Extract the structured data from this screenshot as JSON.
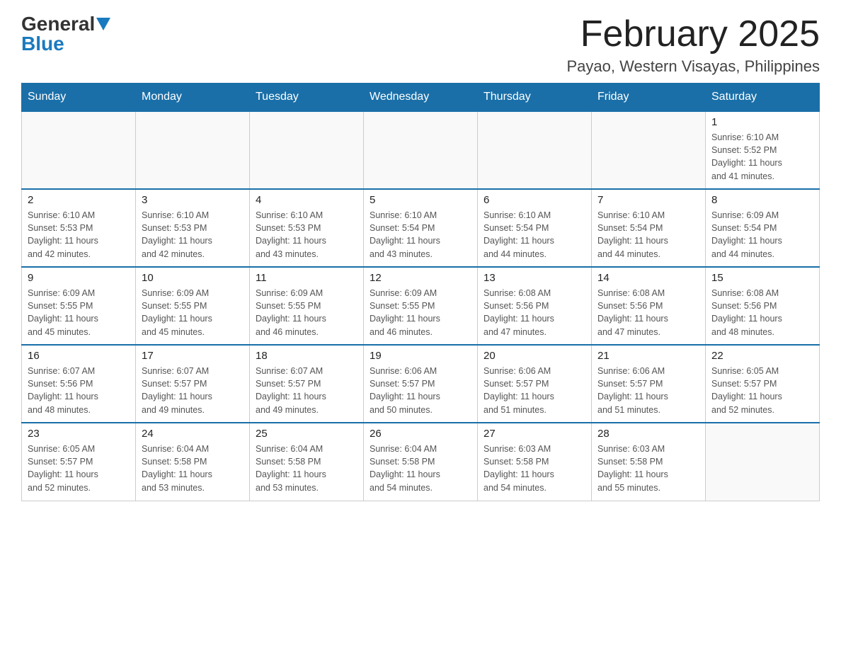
{
  "logo": {
    "general": "General",
    "blue": "Blue"
  },
  "title": {
    "month": "February 2025",
    "location": "Payao, Western Visayas, Philippines"
  },
  "weekdays": [
    "Sunday",
    "Monday",
    "Tuesday",
    "Wednesday",
    "Thursday",
    "Friday",
    "Saturday"
  ],
  "weeks": [
    [
      {
        "day": "",
        "info": ""
      },
      {
        "day": "",
        "info": ""
      },
      {
        "day": "",
        "info": ""
      },
      {
        "day": "",
        "info": ""
      },
      {
        "day": "",
        "info": ""
      },
      {
        "day": "",
        "info": ""
      },
      {
        "day": "1",
        "info": "Sunrise: 6:10 AM\nSunset: 5:52 PM\nDaylight: 11 hours\nand 41 minutes."
      }
    ],
    [
      {
        "day": "2",
        "info": "Sunrise: 6:10 AM\nSunset: 5:53 PM\nDaylight: 11 hours\nand 42 minutes."
      },
      {
        "day": "3",
        "info": "Sunrise: 6:10 AM\nSunset: 5:53 PM\nDaylight: 11 hours\nand 42 minutes."
      },
      {
        "day": "4",
        "info": "Sunrise: 6:10 AM\nSunset: 5:53 PM\nDaylight: 11 hours\nand 43 minutes."
      },
      {
        "day": "5",
        "info": "Sunrise: 6:10 AM\nSunset: 5:54 PM\nDaylight: 11 hours\nand 43 minutes."
      },
      {
        "day": "6",
        "info": "Sunrise: 6:10 AM\nSunset: 5:54 PM\nDaylight: 11 hours\nand 44 minutes."
      },
      {
        "day": "7",
        "info": "Sunrise: 6:10 AM\nSunset: 5:54 PM\nDaylight: 11 hours\nand 44 minutes."
      },
      {
        "day": "8",
        "info": "Sunrise: 6:09 AM\nSunset: 5:54 PM\nDaylight: 11 hours\nand 44 minutes."
      }
    ],
    [
      {
        "day": "9",
        "info": "Sunrise: 6:09 AM\nSunset: 5:55 PM\nDaylight: 11 hours\nand 45 minutes."
      },
      {
        "day": "10",
        "info": "Sunrise: 6:09 AM\nSunset: 5:55 PM\nDaylight: 11 hours\nand 45 minutes."
      },
      {
        "day": "11",
        "info": "Sunrise: 6:09 AM\nSunset: 5:55 PM\nDaylight: 11 hours\nand 46 minutes."
      },
      {
        "day": "12",
        "info": "Sunrise: 6:09 AM\nSunset: 5:55 PM\nDaylight: 11 hours\nand 46 minutes."
      },
      {
        "day": "13",
        "info": "Sunrise: 6:08 AM\nSunset: 5:56 PM\nDaylight: 11 hours\nand 47 minutes."
      },
      {
        "day": "14",
        "info": "Sunrise: 6:08 AM\nSunset: 5:56 PM\nDaylight: 11 hours\nand 47 minutes."
      },
      {
        "day": "15",
        "info": "Sunrise: 6:08 AM\nSunset: 5:56 PM\nDaylight: 11 hours\nand 48 minutes."
      }
    ],
    [
      {
        "day": "16",
        "info": "Sunrise: 6:07 AM\nSunset: 5:56 PM\nDaylight: 11 hours\nand 48 minutes."
      },
      {
        "day": "17",
        "info": "Sunrise: 6:07 AM\nSunset: 5:57 PM\nDaylight: 11 hours\nand 49 minutes."
      },
      {
        "day": "18",
        "info": "Sunrise: 6:07 AM\nSunset: 5:57 PM\nDaylight: 11 hours\nand 49 minutes."
      },
      {
        "day": "19",
        "info": "Sunrise: 6:06 AM\nSunset: 5:57 PM\nDaylight: 11 hours\nand 50 minutes."
      },
      {
        "day": "20",
        "info": "Sunrise: 6:06 AM\nSunset: 5:57 PM\nDaylight: 11 hours\nand 51 minutes."
      },
      {
        "day": "21",
        "info": "Sunrise: 6:06 AM\nSunset: 5:57 PM\nDaylight: 11 hours\nand 51 minutes."
      },
      {
        "day": "22",
        "info": "Sunrise: 6:05 AM\nSunset: 5:57 PM\nDaylight: 11 hours\nand 52 minutes."
      }
    ],
    [
      {
        "day": "23",
        "info": "Sunrise: 6:05 AM\nSunset: 5:57 PM\nDaylight: 11 hours\nand 52 minutes."
      },
      {
        "day": "24",
        "info": "Sunrise: 6:04 AM\nSunset: 5:58 PM\nDaylight: 11 hours\nand 53 minutes."
      },
      {
        "day": "25",
        "info": "Sunrise: 6:04 AM\nSunset: 5:58 PM\nDaylight: 11 hours\nand 53 minutes."
      },
      {
        "day": "26",
        "info": "Sunrise: 6:04 AM\nSunset: 5:58 PM\nDaylight: 11 hours\nand 54 minutes."
      },
      {
        "day": "27",
        "info": "Sunrise: 6:03 AM\nSunset: 5:58 PM\nDaylight: 11 hours\nand 54 minutes."
      },
      {
        "day": "28",
        "info": "Sunrise: 6:03 AM\nSunset: 5:58 PM\nDaylight: 11 hours\nand 55 minutes."
      },
      {
        "day": "",
        "info": ""
      }
    ]
  ]
}
